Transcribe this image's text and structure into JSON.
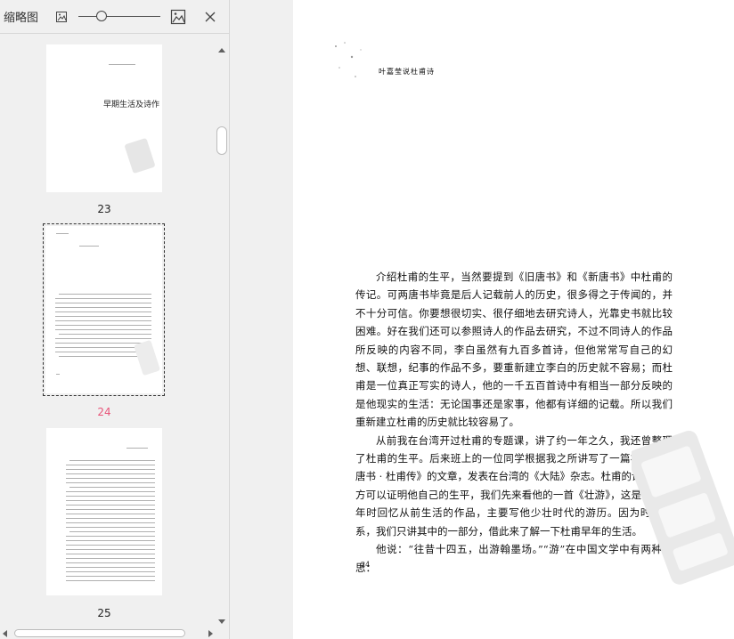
{
  "sidebar": {
    "title": "缩略图",
    "icons": {
      "zoom_out": "small-image-icon",
      "zoom_in": "large-image-icon",
      "close": "close-icon"
    },
    "thumbnails": [
      {
        "page_number": "23",
        "heading": "早期生活及诗作",
        "selected": false
      },
      {
        "page_number": "24",
        "selected": true
      },
      {
        "page_number": "25",
        "selected": false
      }
    ]
  },
  "page": {
    "running_head": "叶嘉莹说杜甫诗",
    "paragraphs": [
      "介绍杜甫的生平，当然要提到《旧唐书》和《新唐书》中杜甫的传记。可两唐书毕竟是后人记载前人的历史，很多得之于传闻的，并不十分可信。你要想很切实、很仔细地去研究诗人，光靠史书就比较困难。好在我们还可以参照诗人的作品去研究，不过不同诗人的作品所反映的内容不同，李白虽然有九百多首诗，但他常常写自己的幻想、联想，纪事的作品不多，要重新建立李白的历史就不容易；而杜甫是一位真正写实的诗人，他的一千五百首诗中有相当一部分反映的是他现实的生活：无论国事还是家事，他都有详细的记载。所以我们重新建立杜甫的历史就比较容易了。",
      "从前我在台湾开过杜甫的专题课，讲了约一年之久，我还曾整理了杜甫的生平。后来班上的一位同学根据我之所讲写了一篇补正《旧唐书 · 杜甫传》的文章，发表在台湾的《大陆》杂志。杜甫的诗很多地方可以证明他自己的生平，我们先来看他的一首《壮游》，这是杜甫晚年时回忆从前生活的作品，主要写他少壮时代的游历。因为时间关系，我们只讲其中的一部分，借此来了解一下杜甫早年的生活。",
      "他说：“往昔十四五，出游翰墨场。”“游”在中国文学中有两种意思："
    ],
    "page_number": "24"
  },
  "colors": {
    "panel_bg": "#f0f0f0",
    "page_bg": "#ffffff",
    "active_page_number": "#e8567a"
  }
}
